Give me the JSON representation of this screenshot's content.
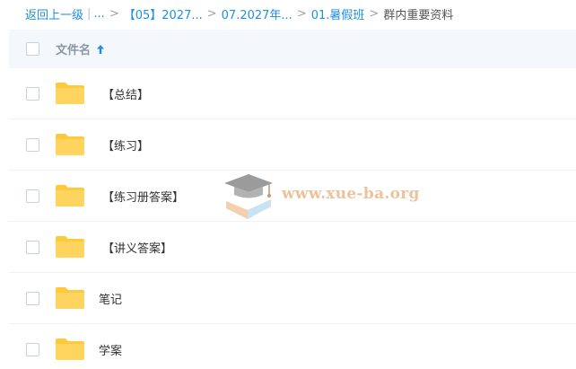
{
  "breadcrumb": {
    "back": "返回上一级",
    "pipe": "|",
    "ellipsis": "...",
    "sep": ">",
    "items": [
      "【05】2027...",
      "07.2027年...",
      "01.暑假班"
    ],
    "current": "群内重要资料"
  },
  "header": {
    "column_name": "文件名",
    "sort_icon": "arrow-up-icon"
  },
  "rows": [
    {
      "name": "【总结】"
    },
    {
      "name": "【练习】"
    },
    {
      "name": "【练习册答案】"
    },
    {
      "name": "【讲义答案】"
    },
    {
      "name": "笔记"
    },
    {
      "name": "学案"
    }
  ],
  "watermark": {
    "text": "www.xue-ba.org",
    "icon": "graduation-cap-book-icon"
  },
  "colors": {
    "link": "#1f8ee0",
    "folder": "#ffc93c",
    "header_bg": "#f4f8fc",
    "watermark": "#e8b98a"
  }
}
